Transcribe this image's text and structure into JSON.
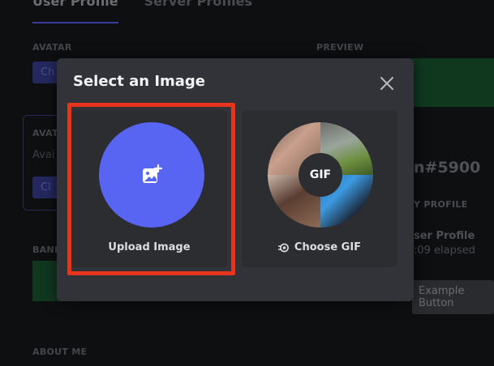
{
  "background": {
    "tabs": [
      "User Profile",
      "Server Profiles"
    ],
    "avatar_label": "AVATAR",
    "preview_label": "PREVIEW",
    "change_avatar_btn": "Ch",
    "avatar_box_label": "AVAT",
    "avatar_box_text": "Avai",
    "avatar_box_btn": "Cl",
    "banner_label": "BANN",
    "about_label": "ABOUT ME",
    "username": "n#5900",
    "profile_label": "Y PROFILE",
    "activity_title": "ser Profile",
    "activity_elapsed": ":09 elapsed",
    "example_button": "Example Button"
  },
  "modal": {
    "title": "Select an Image",
    "upload_label": "Upload Image",
    "gif_badge": "GIF",
    "gif_label": "Choose GIF"
  },
  "colors": {
    "blurple": "#5865f2",
    "modal_bg": "#313338",
    "card_bg": "#2b2d31",
    "highlight": "#e8341c"
  },
  "icons": {
    "close": "close-icon",
    "upload": "image-plus-icon",
    "gif": "gif-sticker-icon"
  }
}
